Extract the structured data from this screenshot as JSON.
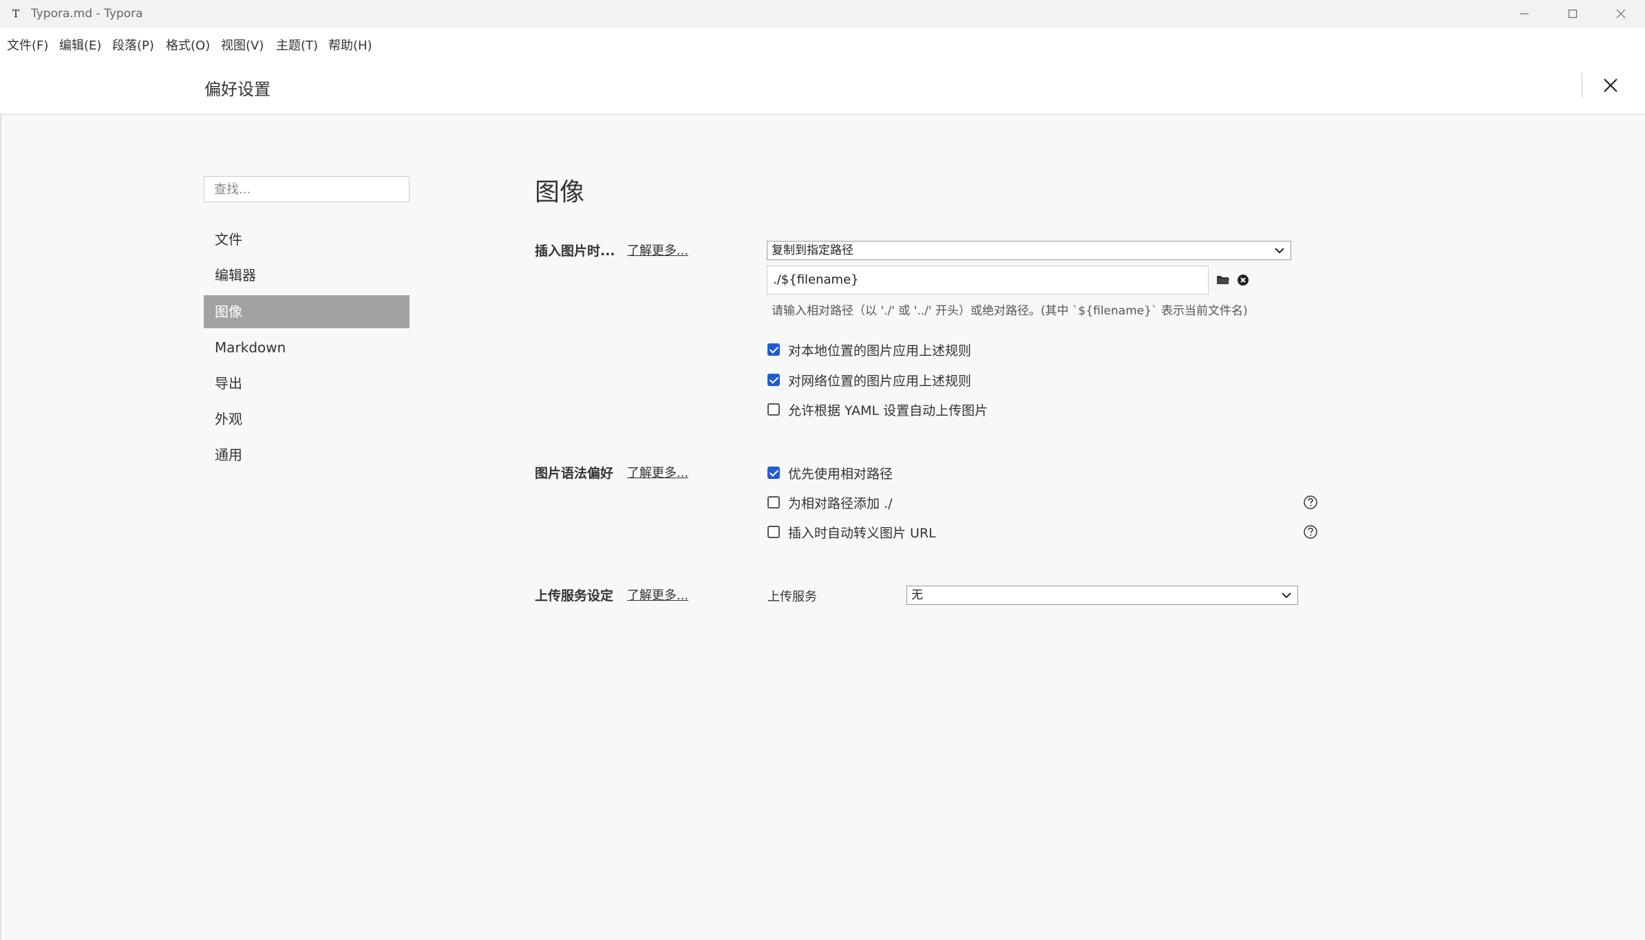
{
  "window": {
    "app_icon": "T",
    "title": "Typora.md - Typora",
    "controls": [
      "minimize-icon",
      "maximize-icon",
      "close-icon"
    ]
  },
  "menu": [
    "文件(F)",
    "编辑(E)",
    "段落(P)",
    "格式(O)",
    "视图(V)",
    "主题(T)",
    "帮助(H)"
  ],
  "prefs": {
    "title": "偏好设置",
    "search_placeholder": "查找...",
    "nav": [
      "文件",
      "编辑器",
      "图像",
      "Markdown",
      "导出",
      "外观",
      "通用"
    ],
    "active_nav": "图像"
  },
  "image": {
    "section_title": "图像",
    "insert": {
      "label": "插入图片时...",
      "learn_more": "了解更多...",
      "action_value": "复制到指定路径",
      "path_value": "./${filename}",
      "hint": "请输入相对路径（以 './' 或 '../' 开头）或绝对路径。(其中 `${filename}` 表示当前文件名)",
      "options": [
        {
          "label": "对本地位置的图片应用上述规则",
          "checked": true
        },
        {
          "label": "对网络位置的图片应用上述规则",
          "checked": true
        },
        {
          "label": "允许根据 YAML 设置自动上传图片",
          "checked": false
        }
      ]
    },
    "syntax": {
      "label": "图片语法偏好",
      "learn_more": "了解更多...",
      "options": [
        {
          "label": "优先使用相对路径",
          "checked": true,
          "help": false
        },
        {
          "label": "为相对路径添加 ./",
          "checked": false,
          "help": true
        },
        {
          "label": "插入时自动转义图片 URL",
          "checked": false,
          "help": true
        }
      ]
    },
    "upload": {
      "label": "上传服务设定",
      "learn_more": "了解更多...",
      "service_label": "上传服务",
      "service_value": "无"
    }
  },
  "colors": {
    "checkbox_checked": "#1f5bd6",
    "nav_active_bg": "#a2a2a2"
  }
}
